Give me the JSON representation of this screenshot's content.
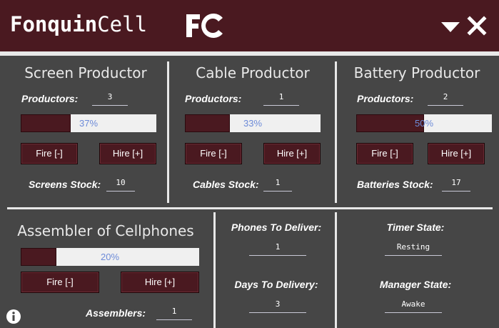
{
  "app": {
    "name_bold": "Fonquin",
    "name_rest": "Cell",
    "logo_icon": "fc-logo-icon",
    "minimize_icon": "chevron-down-icon",
    "close_icon": "close-icon"
  },
  "screen": {
    "title": "Screen Productor",
    "productors_label": "Productors:",
    "productors_value": "3",
    "progress": 0.37,
    "progress_text": "37%",
    "fire_label": "Fire [-]",
    "hire_label": "Hire [+]",
    "stock_label": "Screens Stock:",
    "stock_value": "10"
  },
  "cable": {
    "title": "Cable Productor",
    "productors_label": "Productors:",
    "productors_value": "1",
    "progress": 0.33,
    "progress_text": "33%",
    "fire_label": "Fire [-]",
    "hire_label": "Hire [+]",
    "stock_label": "Cables Stock:",
    "stock_value": "1"
  },
  "battery": {
    "title": "Battery Productor",
    "productors_label": "Productors:",
    "productors_value": "2",
    "progress": 0.5,
    "progress_text": "50%",
    "fire_label": "Fire [-]",
    "hire_label": "Hire [+]",
    "stock_label": "Batteries Stock:",
    "stock_value": "17"
  },
  "assembler": {
    "title": "Assembler of Cellphones",
    "progress": 0.2,
    "progress_text": "20%",
    "fire_label": "Fire [-]",
    "hire_label": "Hire [+]",
    "assemblers_label": "Assemblers:",
    "assemblers_value": "1"
  },
  "delivery": {
    "phones_label": "Phones To Deliver:",
    "phones_value": "1",
    "days_label": "Days To Delivery:",
    "days_value": "3"
  },
  "states": {
    "timer_label": "Timer State:",
    "timer_value": "Resting",
    "manager_label": "Manager State:",
    "manager_value": "Awake"
  },
  "colors": {
    "header_bg": "#4a1920",
    "panel_bg": "#464646",
    "bar_fill": "#4a1920",
    "bar_text": "#6d8bd8"
  },
  "info_icon": "info-icon"
}
